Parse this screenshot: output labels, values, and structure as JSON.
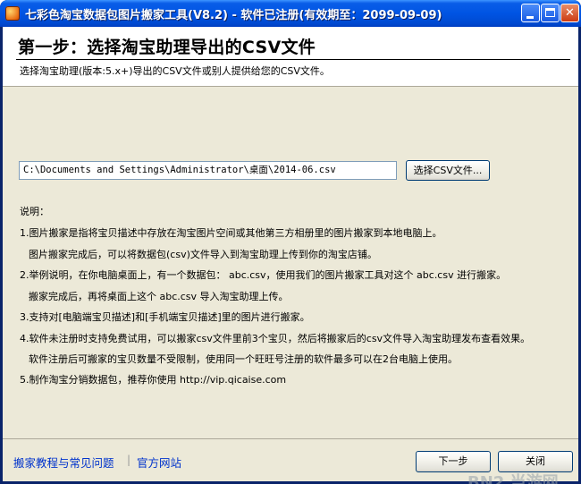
{
  "window": {
    "title": "七彩色淘宝数据包图片搬家工具(V8.2) - 软件已注册(有效期至：2099-09-09)",
    "icon": "app-logo-icon"
  },
  "header": {
    "step_title": "第一步：选择淘宝助理导出的CSV文件",
    "subtitle": "选择淘宝助理(版本:5.x+)导出的CSV文件或别人提供给您的CSV文件。"
  },
  "file_select": {
    "path_value": "C:\\Documents and Settings\\Administrator\\桌面\\2014-06.csv",
    "browse_label": "选择CSV文件..."
  },
  "notes": {
    "title": "说明：",
    "lines": [
      "1.图片搬家是指将宝贝描述中存放在淘宝图片空间或其他第三方相册里的图片搬家到本地电脑上。",
      "图片搬家完成后，可以将数据包(csv)文件导入到淘宝助理上传到你的淘宝店铺。",
      "2.举例说明，在你电脑桌面上，有一个数据包： abc.csv，使用我们的图片搬家工具对这个 abc.csv 进行搬家。",
      "搬家完成后，再将桌面上这个 abc.csv 导入淘宝助理上传。",
      "3.支持对[电脑端宝贝描述]和[手机端宝贝描述]里的图片进行搬家。",
      "4.软件未注册时支持免费试用，可以搬家csv文件里前3个宝贝，然后将搬家后的csv文件导入淘宝助理发布查看效果。",
      "软件注册后可搬家的宝贝数量不受限制，使用同一个旺旺号注册的软件最多可以在2台电脑上使用。",
      "5.制作淘宝分销数据包，推荐你使用 http://vip.qicaise.com"
    ]
  },
  "footer": {
    "link_tutorial": "搬家教程与常见问题",
    "link_separator": "|",
    "link_website": "官方网站",
    "next_label": "下一步",
    "close_label": "关闭",
    "watermark": "BN2 当游网"
  }
}
